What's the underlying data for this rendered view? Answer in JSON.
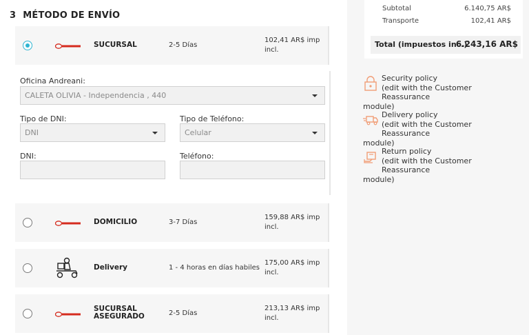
{
  "step": {
    "number": "3",
    "title": "MÉTODO DE ENVÍO"
  },
  "shipping_options": [
    {
      "name_lines": [
        "SUCURSAL"
      ],
      "days": "2-5 Días",
      "price_line1": "102,41 AR$ imp",
      "price_line2": "incl.",
      "selected": true,
      "logo": "andreani-logo"
    },
    {
      "name_lines": [
        "DOMICILIO"
      ],
      "days": "3-7 Días",
      "price_line1": "159,88 AR$ imp",
      "price_line2": "incl.",
      "selected": false,
      "logo": "andreani-logo"
    },
    {
      "name_lines": [
        "Delivery"
      ],
      "days": "1 - 4 horas en días habiles",
      "price_line1": "175,00 AR$ imp",
      "price_line2": "incl.",
      "selected": false,
      "logo": "delivery-scooter-icon"
    },
    {
      "name_lines": [
        "SUCURSAL",
        "ASEGURADO"
      ],
      "days": "2-5 Días",
      "price_line1": "213,13 AR$ imp",
      "price_line2": "incl.",
      "selected": false,
      "logo": "andreani-logo"
    }
  ],
  "form": {
    "office_label": "Oficina Andreani:",
    "office_value": "CALETA OLIVIA - Independencia , 440",
    "dni_type_label": "Tipo de DNI:",
    "dni_type_value": "DNI",
    "phone_type_label": "Tipo de Teléfono:",
    "phone_type_value": "Celular",
    "dni_label": "DNI:",
    "dni_value": "",
    "phone_label": "Teléfono:",
    "phone_value": ""
  },
  "summary": {
    "subtotal_label": "Subtotal",
    "subtotal_value": "6.140,75 AR$",
    "shipping_label": "Transporte",
    "shipping_value": "102,41 AR$",
    "total_label": "Total (impuestos inc.)",
    "total_value": "6.243,16 AR$"
  },
  "reassurance": [
    {
      "title": "Security policy",
      "note": "(edit with the Customer Reassurance",
      "note2": "module)",
      "icon": "lock-icon"
    },
    {
      "title": "Delivery policy",
      "note": "(edit with the Customer Reassurance",
      "note2": "module)",
      "icon": "truck-icon"
    },
    {
      "title": "Return policy",
      "note": "(edit with the Customer Reassurance",
      "note2": "module)",
      "icon": "return-box-icon"
    }
  ],
  "colors": {
    "accent": "#2fb5d2",
    "andreani_red": "#d52b1e",
    "icon_orange": "#f19d76"
  }
}
